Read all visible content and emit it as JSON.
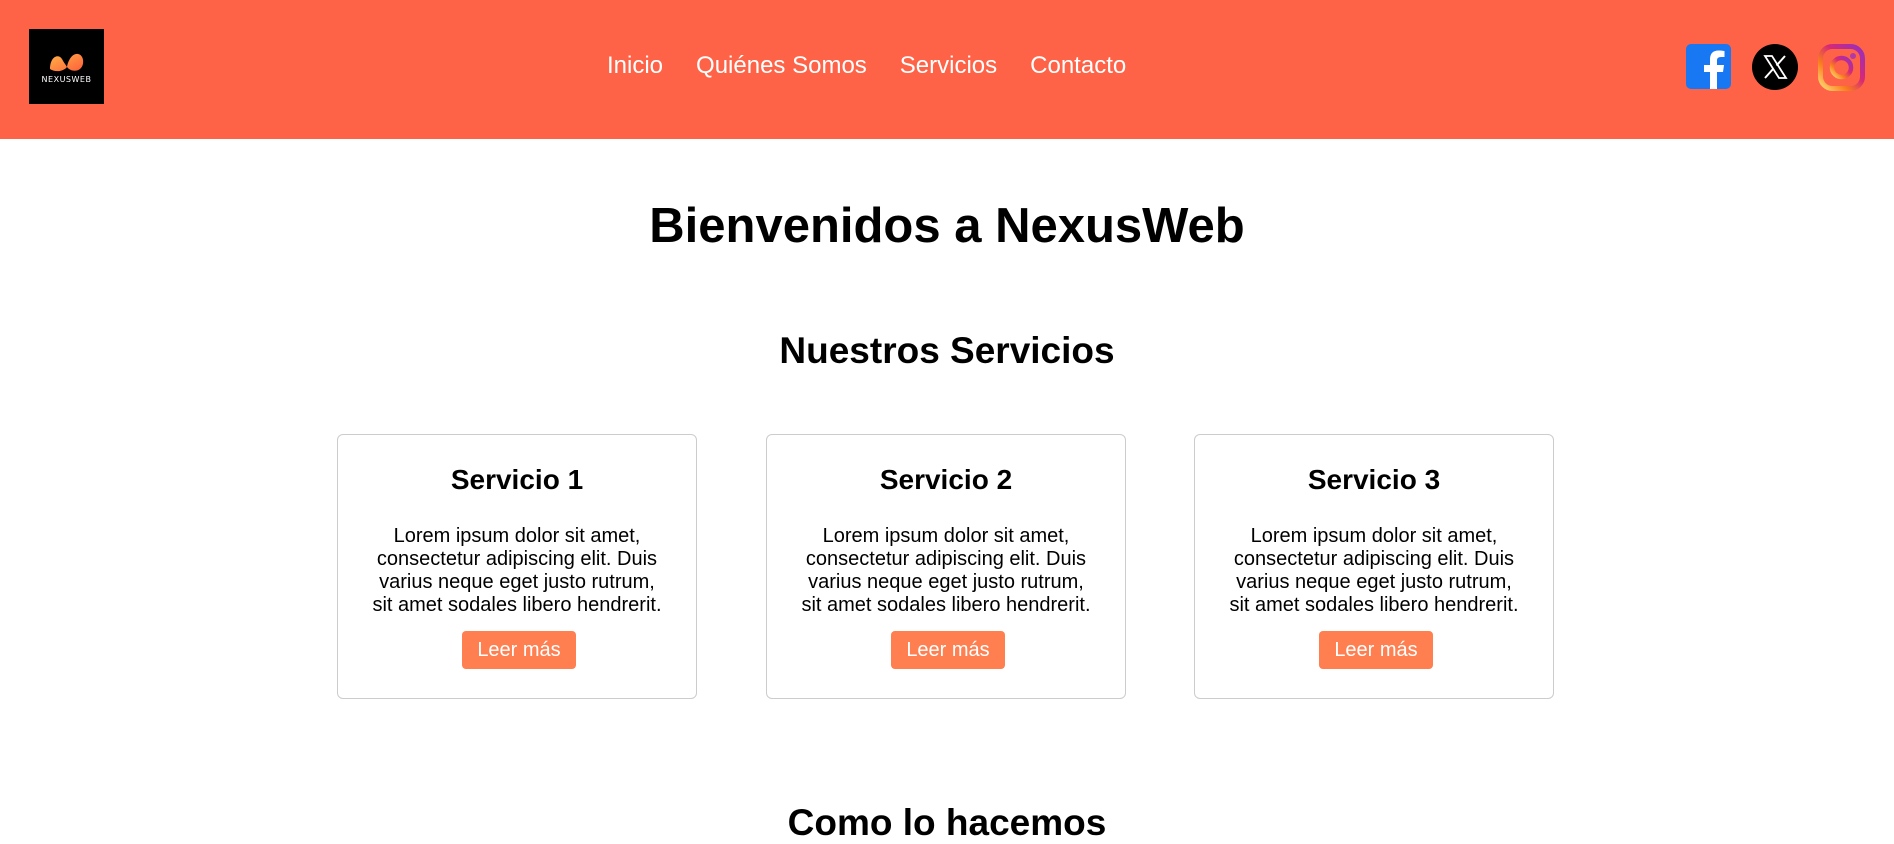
{
  "header": {
    "logo_text": "NEXUSWEB",
    "background_color": "#ff6347",
    "nav": [
      {
        "label": "Inicio"
      },
      {
        "label": "Quiénes Somos"
      },
      {
        "label": "Servicios"
      },
      {
        "label": "Contacto"
      }
    ],
    "social": [
      {
        "icon": "facebook-icon"
      },
      {
        "icon": "x-icon"
      },
      {
        "icon": "instagram-icon"
      }
    ]
  },
  "main": {
    "title": "Bienvenidos a NexusWeb",
    "services_title": "Nuestros Servicios",
    "services": [
      {
        "title": "Servicio 1",
        "text": "Lorem ipsum dolor sit amet, consectetur adipiscing elit. Duis varius neque eget justo rutrum, sit amet sodales libero hendrerit.",
        "button": "Leer más"
      },
      {
        "title": "Servicio 2",
        "text": "Lorem ipsum dolor sit amet, consectetur adipiscing elit. Duis varius neque eget justo rutrum, sit amet sodales libero hendrerit.",
        "button": "Leer más"
      },
      {
        "title": "Servicio 3",
        "text": "Lorem ipsum dolor sit amet, consectetur adipiscing elit. Duis varius neque eget justo rutrum, sit amet sodales libero hendrerit.",
        "button": "Leer más"
      }
    ],
    "button_color": "#ff7f50",
    "how_title": "Como lo hacemos"
  }
}
